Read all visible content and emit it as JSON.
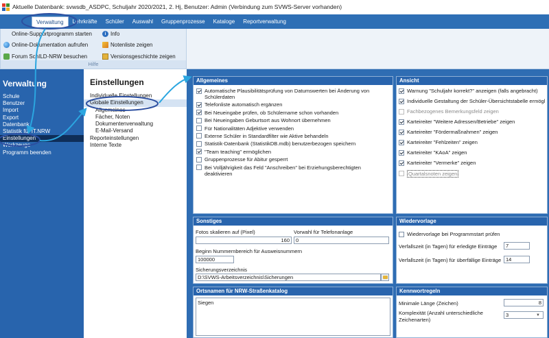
{
  "window": {
    "title": "Aktuelle Datenbank: svwsdb_ASDPC, Schuljahr 2020/2021, 2. Hj, Benutzer: Admin (Verbindung zum SVWS-Server vorhanden)"
  },
  "menubar": {
    "items": [
      "Verwaltung",
      "Lehrkräfte",
      "Schüler",
      "Auswahl",
      "Gruppenprozesse",
      "Kataloge",
      "Reportverwaltung"
    ]
  },
  "ribbon": {
    "online_support": "Online-Supportprogramm starten",
    "online_docs": "Online-Dokumentation aufrufen",
    "forum": "Forum SchILD-NRW besuchen",
    "info": "Info",
    "notenliste": "Notenliste zeigen",
    "versionsgeschichte": "Versionsgeschichte zeigen",
    "group_label": "Hilfe"
  },
  "leftnav": {
    "title": "Verwaltung",
    "items": [
      "Schule",
      "Benutzer",
      "Import",
      "Export",
      "Datenbank",
      "Statistik für IT.NRW",
      "Einstellungen",
      "Werkzeuge",
      "Programm beenden"
    ]
  },
  "subnav": {
    "title": "Einstellungen",
    "items": [
      {
        "label": "Individuelle Einstellungen",
        "level": 1
      },
      {
        "label": "Globale Einstellungen",
        "level": 1
      },
      {
        "label": "Allgemeines",
        "level": 2
      },
      {
        "label": "Fächer, Noten",
        "level": 2
      },
      {
        "label": "Dokumentenverwaltung",
        "level": 2
      },
      {
        "label": "E-Mail-Versand",
        "level": 2
      },
      {
        "label": "Reporteinstellungen",
        "level": 1
      },
      {
        "label": "Interne Texte",
        "level": 1
      }
    ]
  },
  "allgemeines": {
    "title": "Allgemeines",
    "options": [
      {
        "label": "Automatische Plausibilitätsprüfung von Datumswerten bei Änderung von Schülerdaten",
        "checked": true
      },
      {
        "label": "Telefonliste automatisch ergänzen",
        "checked": true
      },
      {
        "label": "Bei Neueingabe prüfen, ob Schülername schon vorhanden",
        "checked": true
      },
      {
        "label": "Bei Neueingaben Geburtsort aus Wohnort übernehmen",
        "checked": false
      },
      {
        "label": "Für Nationalitäten Adjektive verwenden",
        "checked": false
      },
      {
        "label": "Externe Schüler in Standardfilter wie Aktive behandeln",
        "checked": false
      },
      {
        "label": "Statistik-Datenbank (StatistikDB.mdb) benutzerbezogen speichern",
        "checked": false
      },
      {
        "label": "\"Team teaching\" ermöglichen",
        "checked": true
      },
      {
        "label": "Gruppenprozesse für Abitur gesperrt",
        "checked": false
      },
      {
        "label": "Bei Volljährigkeit das Feld \"Anschreiben\" bei Erziehungsberechtigten deaktivieren",
        "checked": false
      }
    ]
  },
  "ansicht": {
    "title": "Ansicht",
    "options": [
      {
        "label": "Warnung \"Schuljahr korrekt?\" anzeigen (falls angebracht)",
        "checked": true,
        "disabled": false
      },
      {
        "label": "Individuelle Gestaltung der Schüler-Übersichtstabelle ermöglichen",
        "checked": true,
        "disabled": false
      },
      {
        "label": "Fachbezogenes Bemerkungsfeld zeigen",
        "checked": false,
        "disabled": true
      },
      {
        "label": "Karteireiter \"Weitere Adressen/Betriebe\" zeigen",
        "checked": true,
        "disabled": false
      },
      {
        "label": "Karteireiter \"Fördermaßnahmen\" zeigen",
        "checked": true,
        "disabled": false
      },
      {
        "label": "Karteireiter \"Fehlzeiten\" zeigen",
        "checked": true,
        "disabled": false
      },
      {
        "label": "Karteireiter \"KAoA\" zeigen",
        "checked": true,
        "disabled": false
      },
      {
        "label": "Karteireiter \"Vermerke\" zeigen",
        "checked": true,
        "disabled": false
      },
      {
        "label": "Quartalsnoten zeigen",
        "checked": false,
        "disabled": true
      }
    ]
  },
  "sonstiges": {
    "title": "Sonstiges",
    "fotos_label": "Fotos skalieren auf (Pixel)",
    "fotos_value": "160",
    "vorwahl_label": "Vorwahl für Telefonanlage",
    "vorwahl_value": "0",
    "nummern_label": "Beginn Nummernbereich für Ausweisnummern",
    "nummern_value": "100000",
    "sicherung_label": "Sicherungsverzeichnis",
    "sicherung_value": "D:\\SVWS-Arbeitsverzeichnis\\Sicherungen"
  },
  "wiedervorlage": {
    "title": "Wiedervorlage",
    "start_label": "Wiedervorlage bei Programmstart prüfen",
    "start_checked": false,
    "erledigt_label": "Verfallszeit (in Tagen) für erledigte Einträge",
    "erledigt_value": "7",
    "ueberfaellig_label": "Verfallszeit (in Tagen) für überfällige Einträge",
    "ueberfaellig_value": "14"
  },
  "ortsnamen": {
    "title": "Ortsnamen für NRW-Straßenkatalog",
    "value": "Siegen"
  },
  "kennwort": {
    "title": "Kennwortregeln",
    "min_label": "Minimale Länge (Zeichen)",
    "min_value": "8",
    "komplex_label": "Komplexität (Anzahl unterschiedliche Zeichenarten)",
    "komplex_value": "3"
  },
  "colors": {
    "menubar": "#2e6fb5",
    "nav": "#2864ad",
    "nav_selected": "#0f2e58",
    "annotation": "#2ba6e0"
  }
}
